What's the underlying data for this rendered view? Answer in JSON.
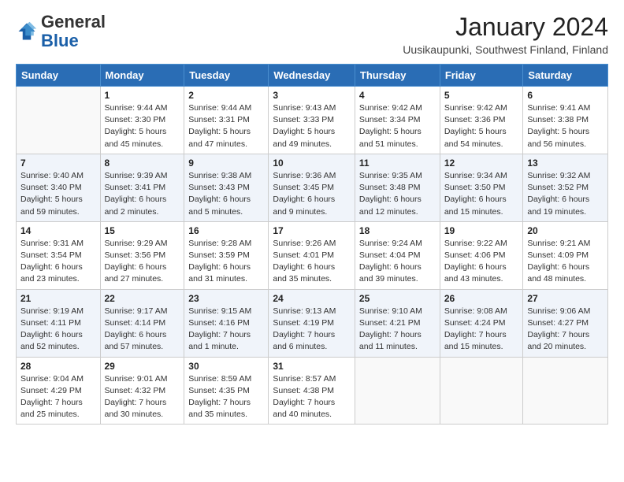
{
  "logo": {
    "general": "General",
    "blue": "Blue"
  },
  "header": {
    "month_year": "January 2024",
    "location": "Uusikaupunki, Southwest Finland, Finland"
  },
  "weekdays": [
    "Sunday",
    "Monday",
    "Tuesday",
    "Wednesday",
    "Thursday",
    "Friday",
    "Saturday"
  ],
  "weeks": [
    [
      {
        "day": "",
        "content": ""
      },
      {
        "day": "1",
        "content": "Sunrise: 9:44 AM\nSunset: 3:30 PM\nDaylight: 5 hours\nand 45 minutes."
      },
      {
        "day": "2",
        "content": "Sunrise: 9:44 AM\nSunset: 3:31 PM\nDaylight: 5 hours\nand 47 minutes."
      },
      {
        "day": "3",
        "content": "Sunrise: 9:43 AM\nSunset: 3:33 PM\nDaylight: 5 hours\nand 49 minutes."
      },
      {
        "day": "4",
        "content": "Sunrise: 9:42 AM\nSunset: 3:34 PM\nDaylight: 5 hours\nand 51 minutes."
      },
      {
        "day": "5",
        "content": "Sunrise: 9:42 AM\nSunset: 3:36 PM\nDaylight: 5 hours\nand 54 minutes."
      },
      {
        "day": "6",
        "content": "Sunrise: 9:41 AM\nSunset: 3:38 PM\nDaylight: 5 hours\nand 56 minutes."
      }
    ],
    [
      {
        "day": "7",
        "content": "Sunrise: 9:40 AM\nSunset: 3:40 PM\nDaylight: 5 hours\nand 59 minutes."
      },
      {
        "day": "8",
        "content": "Sunrise: 9:39 AM\nSunset: 3:41 PM\nDaylight: 6 hours\nand 2 minutes."
      },
      {
        "day": "9",
        "content": "Sunrise: 9:38 AM\nSunset: 3:43 PM\nDaylight: 6 hours\nand 5 minutes."
      },
      {
        "day": "10",
        "content": "Sunrise: 9:36 AM\nSunset: 3:45 PM\nDaylight: 6 hours\nand 9 minutes."
      },
      {
        "day": "11",
        "content": "Sunrise: 9:35 AM\nSunset: 3:48 PM\nDaylight: 6 hours\nand 12 minutes."
      },
      {
        "day": "12",
        "content": "Sunrise: 9:34 AM\nSunset: 3:50 PM\nDaylight: 6 hours\nand 15 minutes."
      },
      {
        "day": "13",
        "content": "Sunrise: 9:32 AM\nSunset: 3:52 PM\nDaylight: 6 hours\nand 19 minutes."
      }
    ],
    [
      {
        "day": "14",
        "content": "Sunrise: 9:31 AM\nSunset: 3:54 PM\nDaylight: 6 hours\nand 23 minutes."
      },
      {
        "day": "15",
        "content": "Sunrise: 9:29 AM\nSunset: 3:56 PM\nDaylight: 6 hours\nand 27 minutes."
      },
      {
        "day": "16",
        "content": "Sunrise: 9:28 AM\nSunset: 3:59 PM\nDaylight: 6 hours\nand 31 minutes."
      },
      {
        "day": "17",
        "content": "Sunrise: 9:26 AM\nSunset: 4:01 PM\nDaylight: 6 hours\nand 35 minutes."
      },
      {
        "day": "18",
        "content": "Sunrise: 9:24 AM\nSunset: 4:04 PM\nDaylight: 6 hours\nand 39 minutes."
      },
      {
        "day": "19",
        "content": "Sunrise: 9:22 AM\nSunset: 4:06 PM\nDaylight: 6 hours\nand 43 minutes."
      },
      {
        "day": "20",
        "content": "Sunrise: 9:21 AM\nSunset: 4:09 PM\nDaylight: 6 hours\nand 48 minutes."
      }
    ],
    [
      {
        "day": "21",
        "content": "Sunrise: 9:19 AM\nSunset: 4:11 PM\nDaylight: 6 hours\nand 52 minutes."
      },
      {
        "day": "22",
        "content": "Sunrise: 9:17 AM\nSunset: 4:14 PM\nDaylight: 6 hours\nand 57 minutes."
      },
      {
        "day": "23",
        "content": "Sunrise: 9:15 AM\nSunset: 4:16 PM\nDaylight: 7 hours\nand 1 minute."
      },
      {
        "day": "24",
        "content": "Sunrise: 9:13 AM\nSunset: 4:19 PM\nDaylight: 7 hours\nand 6 minutes."
      },
      {
        "day": "25",
        "content": "Sunrise: 9:10 AM\nSunset: 4:21 PM\nDaylight: 7 hours\nand 11 minutes."
      },
      {
        "day": "26",
        "content": "Sunrise: 9:08 AM\nSunset: 4:24 PM\nDaylight: 7 hours\nand 15 minutes."
      },
      {
        "day": "27",
        "content": "Sunrise: 9:06 AM\nSunset: 4:27 PM\nDaylight: 7 hours\nand 20 minutes."
      }
    ],
    [
      {
        "day": "28",
        "content": "Sunrise: 9:04 AM\nSunset: 4:29 PM\nDaylight: 7 hours\nand 25 minutes."
      },
      {
        "day": "29",
        "content": "Sunrise: 9:01 AM\nSunset: 4:32 PM\nDaylight: 7 hours\nand 30 minutes."
      },
      {
        "day": "30",
        "content": "Sunrise: 8:59 AM\nSunset: 4:35 PM\nDaylight: 7 hours\nand 35 minutes."
      },
      {
        "day": "31",
        "content": "Sunrise: 8:57 AM\nSunset: 4:38 PM\nDaylight: 7 hours\nand 40 minutes."
      },
      {
        "day": "",
        "content": ""
      },
      {
        "day": "",
        "content": ""
      },
      {
        "day": "",
        "content": ""
      }
    ]
  ]
}
